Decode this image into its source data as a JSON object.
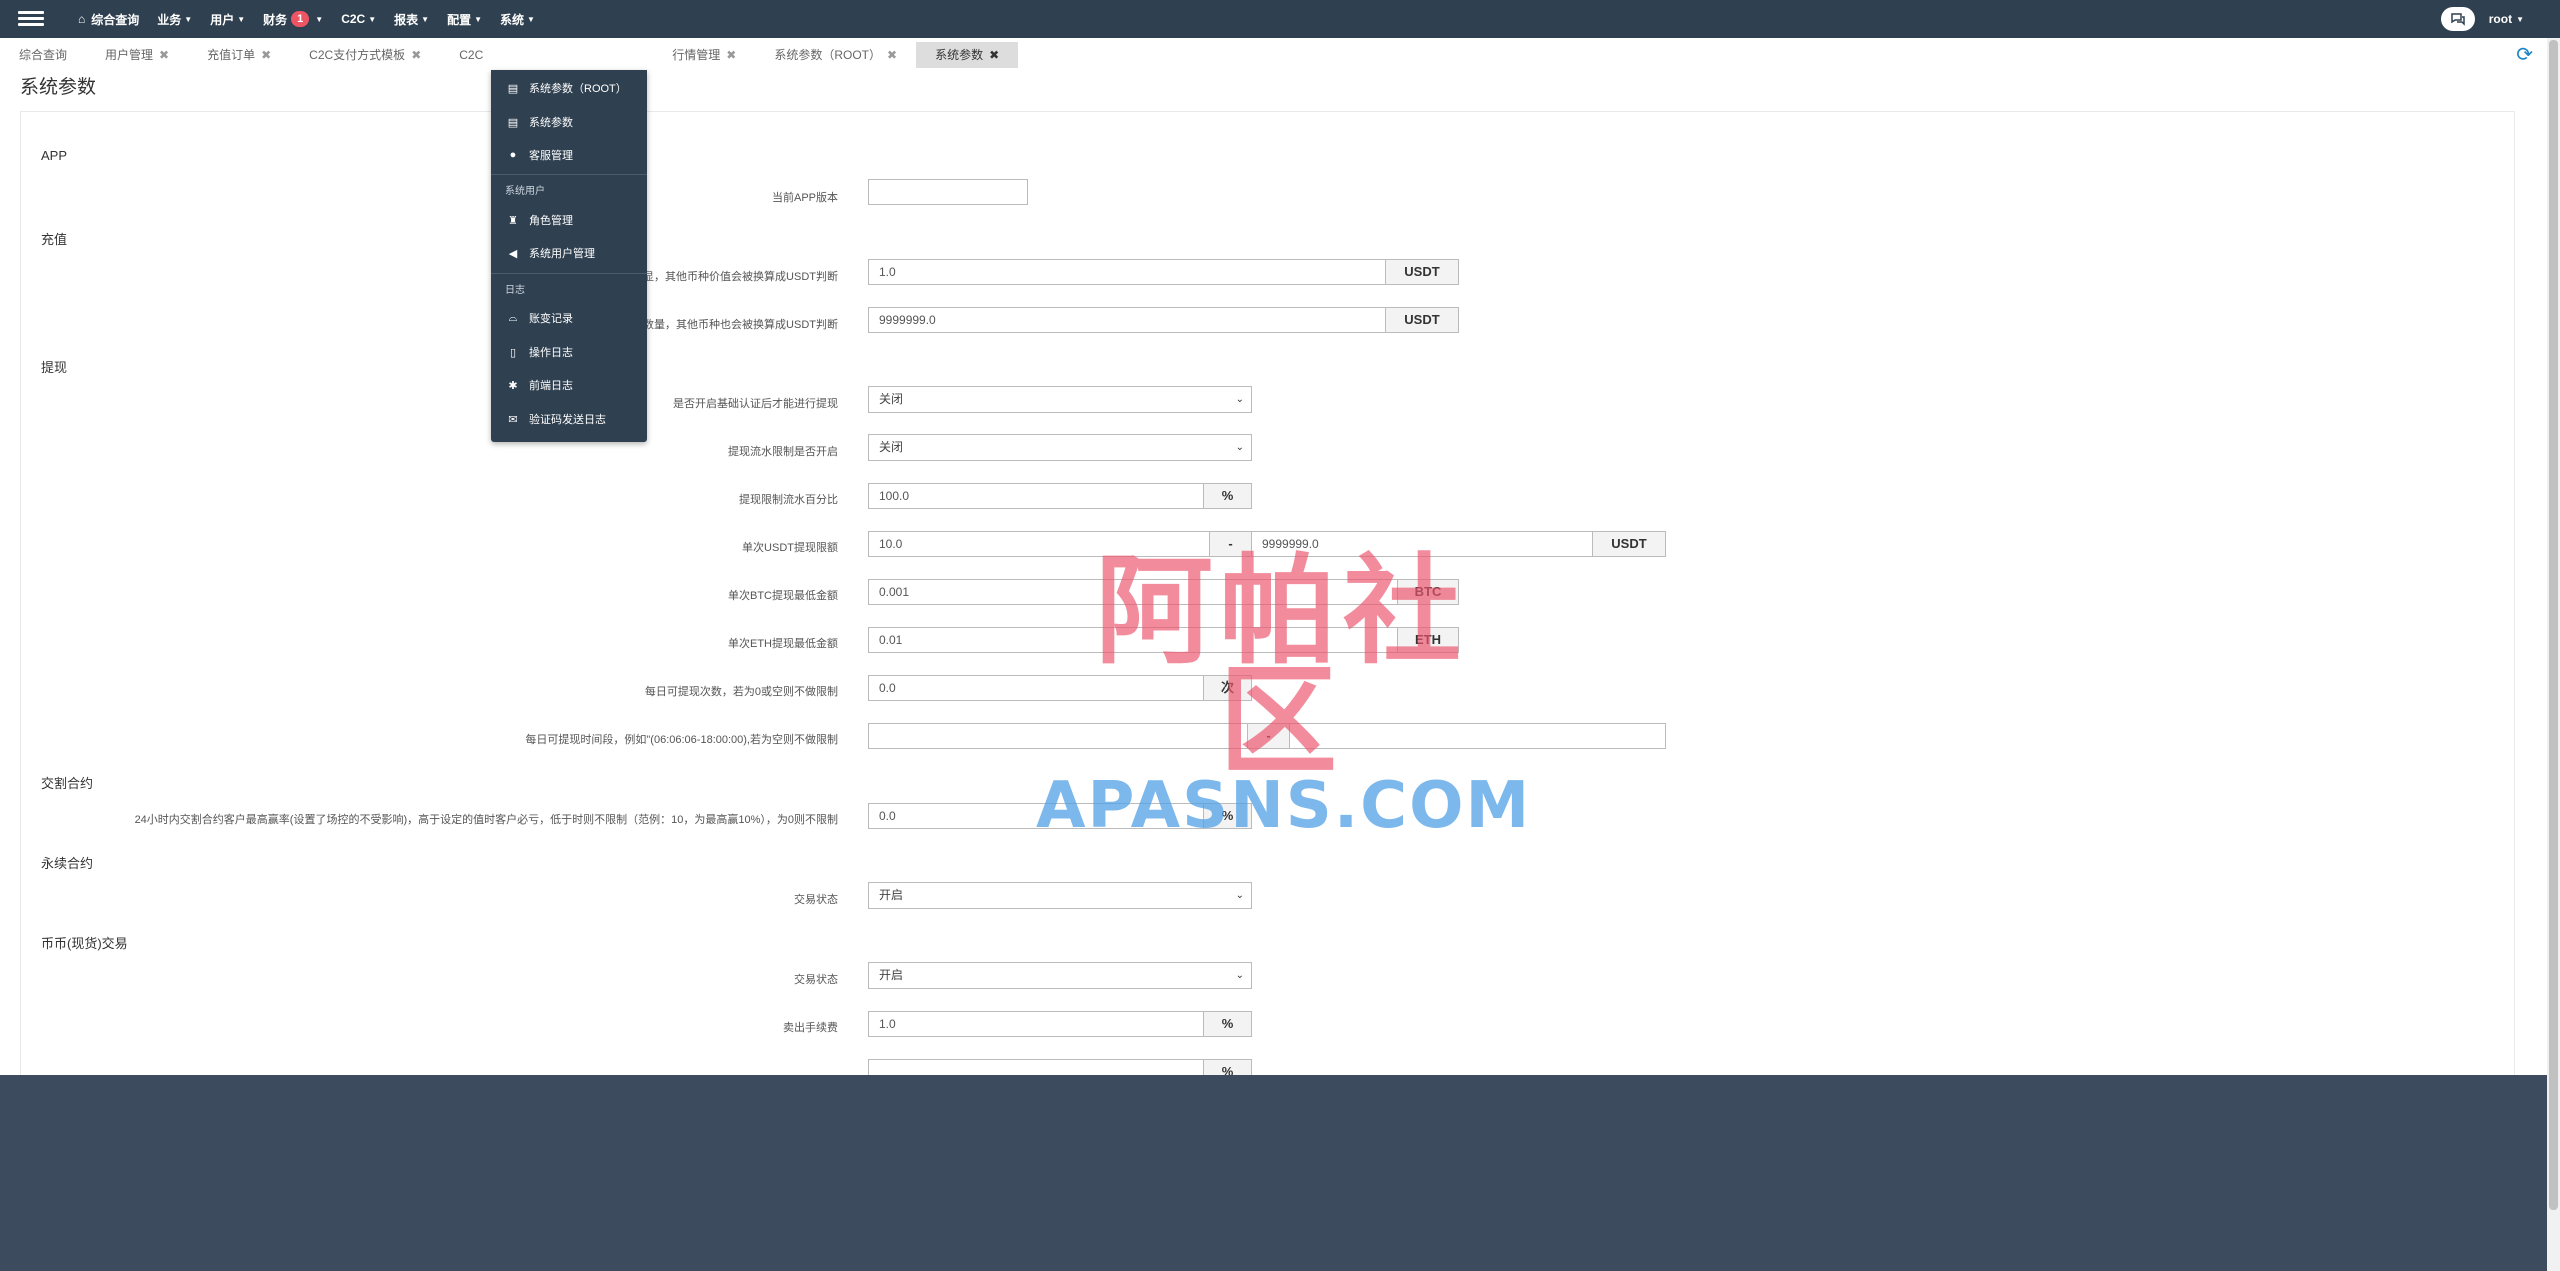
{
  "topbar": {
    "menu": [
      {
        "label": "综合查询"
      },
      {
        "label": "业务"
      },
      {
        "label": "用户"
      },
      {
        "label": "财务",
        "badge": "1"
      },
      {
        "label": "C2C"
      },
      {
        "label": "报表"
      },
      {
        "label": "配置"
      },
      {
        "label": "系统"
      }
    ],
    "user": "root"
  },
  "tabs": [
    {
      "label": "综合查询",
      "closable": false
    },
    {
      "label": "用户管理",
      "closable": true
    },
    {
      "label": "充值订单",
      "closable": true
    },
    {
      "label": "C2C支付方式模板",
      "closable": true
    },
    {
      "label": "C2C",
      "closable": false
    },
    {
      "label": "行情管理",
      "closable": true
    },
    {
      "label": "系统参数（ROOT）",
      "closable": true
    },
    {
      "label": "系统参数",
      "closable": true,
      "active": true
    }
  ],
  "page_title": "系统参数",
  "dropdown": {
    "items1": [
      "系统参数（ROOT）",
      "系统参数",
      "客服管理"
    ],
    "group2_header": "系统用户",
    "items2": [
      "角色管理",
      "系统用户管理"
    ],
    "group3_header": "日志",
    "items3": [
      "账变记录",
      "操作日志",
      "前端日志",
      "验证码发送日志"
    ]
  },
  "sections": {
    "app": "APP",
    "recharge": "充值",
    "withdraw": "提现",
    "delivery": "交割合约",
    "perpetual": "永续合约",
    "spot": "币币(现货)交易"
  },
  "fields": {
    "app_version_label": "当前APP版本",
    "app_version_value": "",
    "recharge_min_label": "显，其他币种价值会被换算成USDT判断",
    "recharge_min_value": "1.0",
    "recharge_max_label": "数量，其他币种也会被换算成USDT判断",
    "recharge_max_value": "9999999.0",
    "usdt_unit": "USDT",
    "kyc_label": "是否开启基础认证后才能进行提现",
    "kyc_value": "关闭",
    "flow_label": "提现流水限制是否开启",
    "flow_value": "关闭",
    "flow_pct_label": "提现限制流水百分比",
    "flow_pct_value": "100.0",
    "pct_unit": "%",
    "usdt_limit_label": "单次USDT提现限额",
    "usdt_limit_min": "10.0",
    "usdt_limit_max": "9999999.0",
    "dash": "-",
    "btc_label": "单次BTC提现最低金额",
    "btc_value": "0.001",
    "btc_unit": "BTC",
    "eth_label": "单次ETH提现最低金额",
    "eth_value": "0.01",
    "eth_unit": "ETH",
    "daily_times_label": "每日可提现次数，若为0或空则不做限制",
    "daily_times_value": "0.0",
    "times_unit": "次",
    "time_window_label": "每日可提现时间段，例如\"(06:06:06-18:00:00),若为空则不做限制",
    "delivery_label": "24小时内交割合约客户最高赢率(设置了场控的不受影响)，高于设定的值时客户必亏，低于时则不限制（范例：10，为最高赢10%），为0则不限制",
    "delivery_value": "0.0",
    "perp_status_label": "交易状态",
    "perp_status_value": "开启",
    "spot_status_label": "交易状态",
    "spot_status_value": "开启",
    "spot_fee_label": "卖出手续费",
    "spot_fee_value": "1.0"
  },
  "watermark": {
    "cn": "阿帕社区",
    "en": "APASNS.COM"
  }
}
